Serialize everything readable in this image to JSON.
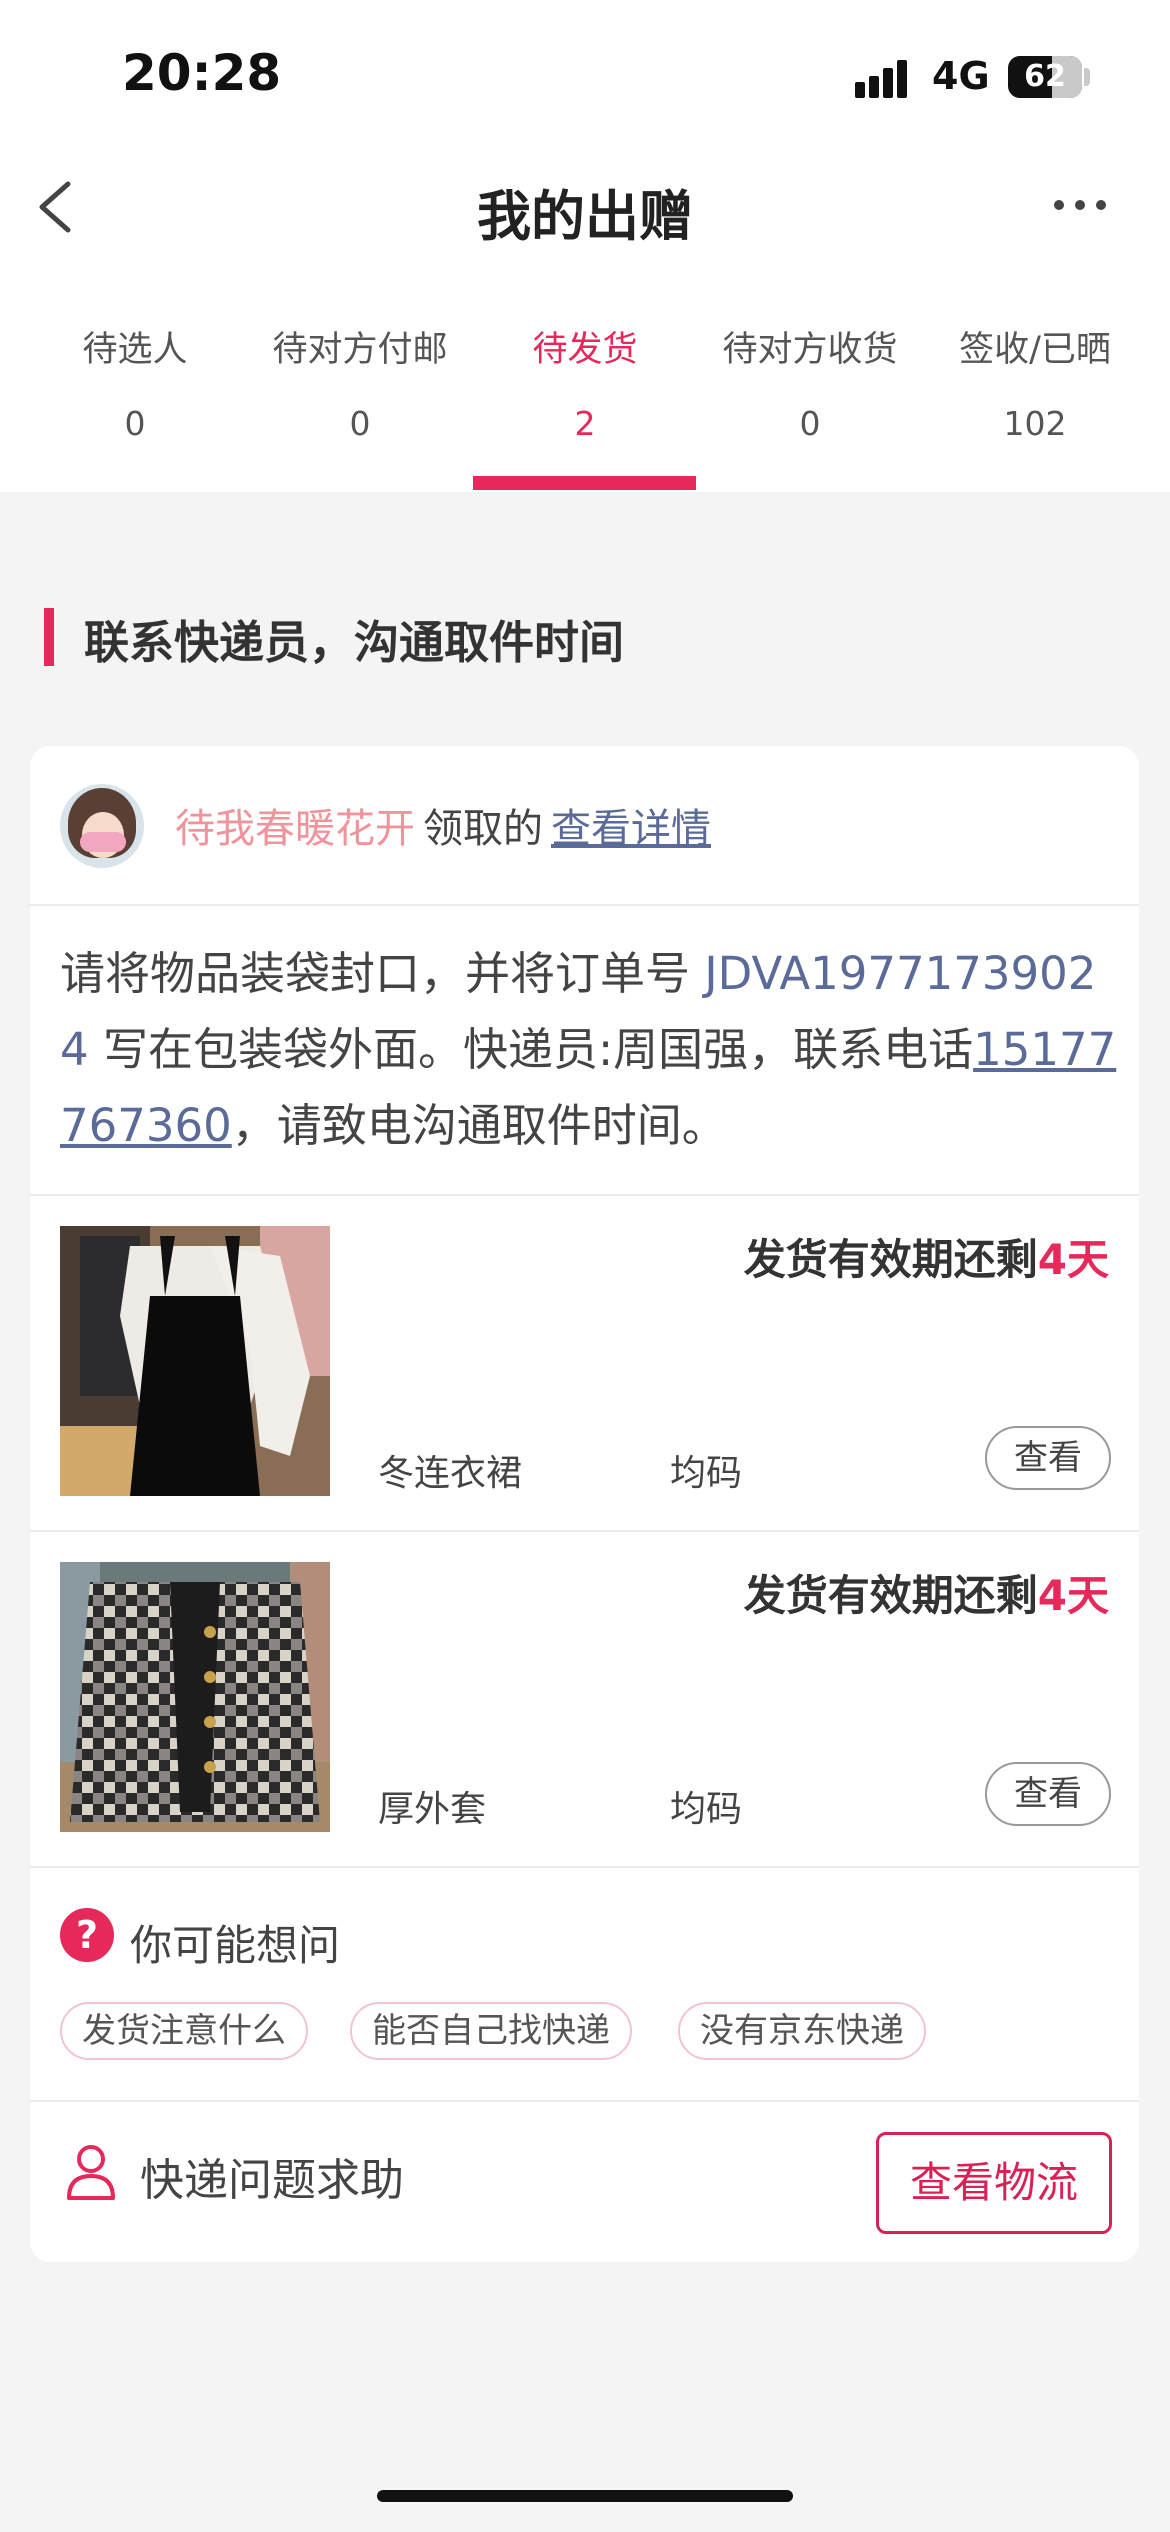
{
  "status_bar": {
    "time": "20:28",
    "network": "4G",
    "battery": "62"
  },
  "nav": {
    "title": "我的出赠"
  },
  "tabs": [
    {
      "label": "待选人",
      "count": "0"
    },
    {
      "label": "待对方付邮",
      "count": "0"
    },
    {
      "label": "待发货",
      "count": "2",
      "active": true
    },
    {
      "label": "待对方收货",
      "count": "0"
    },
    {
      "label": "签收/已晒",
      "count": "102"
    }
  ],
  "section": {
    "title": "联系快递员，沟通取件时间"
  },
  "card": {
    "claimer_nickname": "待我春暖花开",
    "claimed_text": "领取的",
    "detail_link": "查看详情",
    "instruction": {
      "prefix": "请将物品装袋封口，并将订单号 ",
      "order_no": "JDVA19771739024",
      "middle": " 写在包装袋外面。快递员:周国强，联系电话",
      "phone": "15177767360",
      "suffix": "，请致电沟通取件时间。"
    },
    "items": [
      {
        "deadline_text": "发货有效期还剩",
        "days": "4天",
        "name": "冬连衣裙",
        "size": "均码",
        "view_label": "查看"
      },
      {
        "deadline_text": "发货有效期还剩",
        "days": "4天",
        "name": "厚外套",
        "size": "均码",
        "view_label": "查看"
      }
    ],
    "faq": {
      "icon": "question-icon",
      "title": "你可能想问",
      "chips": [
        "发货注意什么",
        "能否自己找快递",
        "没有京东快递"
      ]
    },
    "help_label": "快递问题求助",
    "logistics_button": "查看物流"
  },
  "colors": {
    "accent": "#e6285a",
    "link": "#5a6b99",
    "nickname": "#f0949c"
  }
}
